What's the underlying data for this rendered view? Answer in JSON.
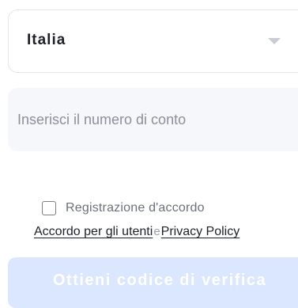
{
  "country_select": {
    "value": "Italia",
    "icon": "chevron-down-icon"
  },
  "account_field": {
    "value": "",
    "placeholder": "Inserisci il numero di conto"
  },
  "agreement": {
    "checked": false,
    "label": "Registrazione d'accordo",
    "user_agreement_link": "Accordo per gli utenti",
    "separator": "e",
    "privacy_policy_link": "Privacy Policy"
  },
  "submit_button": {
    "label": "Ottieni codice di verifica"
  },
  "colors": {
    "button_disabled_bg": "#dbe6ff",
    "input_bg": "#f5f7fb",
    "border": "#e3e5ea",
    "text_primary": "#1e2128",
    "text_placeholder": "#8b909a"
  }
}
